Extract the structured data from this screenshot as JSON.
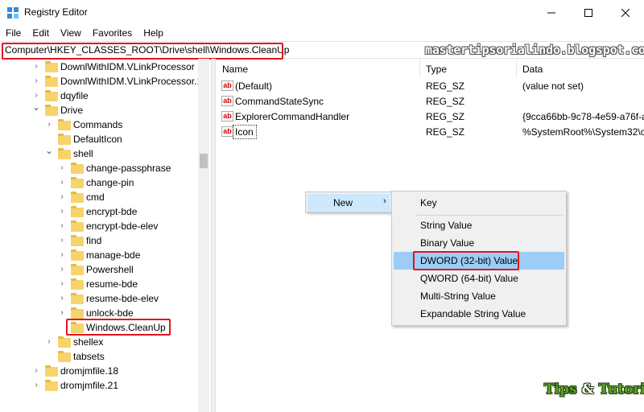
{
  "window": {
    "title": "Registry Editor"
  },
  "menu": [
    "File",
    "Edit",
    "View",
    "Favorites",
    "Help"
  ],
  "address": "Computer\\HKEY_CLASSES_ROOT\\Drive\\shell\\Windows.CleanUp",
  "watermark_url": "mastertipsorialindo.blogspot.com",
  "tree": [
    {
      "label": "DownlWithIDM.VLinkProcessor",
      "expander": "chevron-right"
    },
    {
      "label": "DownlWithIDM.VLinkProcessor.1",
      "expander": "chevron-right"
    },
    {
      "label": "dqyfile",
      "expander": "chevron-right"
    },
    {
      "label": "Drive",
      "expander": "chevron-down"
    },
    {
      "label": "Commands",
      "expander": "chevron-right"
    },
    {
      "label": "DefaultIcon",
      "expander": "none"
    },
    {
      "label": "shell",
      "expander": "chevron-down"
    },
    {
      "label": "change-passphrase",
      "expander": "chevron-right"
    },
    {
      "label": "change-pin",
      "expander": "chevron-right"
    },
    {
      "label": "cmd",
      "expander": "chevron-right"
    },
    {
      "label": "encrypt-bde",
      "expander": "chevron-right"
    },
    {
      "label": "encrypt-bde-elev",
      "expander": "chevron-right"
    },
    {
      "label": "find",
      "expander": "chevron-right"
    },
    {
      "label": "manage-bde",
      "expander": "chevron-right"
    },
    {
      "label": "Powershell",
      "expander": "chevron-right"
    },
    {
      "label": "resume-bde",
      "expander": "chevron-right"
    },
    {
      "label": "resume-bde-elev",
      "expander": "chevron-right"
    },
    {
      "label": "unlock-bde",
      "expander": "chevron-right"
    },
    {
      "label": "Windows.CleanUp",
      "expander": "none"
    },
    {
      "label": "shellex",
      "expander": "chevron-right"
    },
    {
      "label": "tabsets",
      "expander": "none"
    },
    {
      "label": "dromjmfile.18",
      "expander": "chevron-right"
    },
    {
      "label": "dromjmfile.21",
      "expander": "chevron-right"
    }
  ],
  "columns": {
    "name": "Name",
    "type": "Type",
    "data": "Data"
  },
  "values": [
    {
      "name": "(Default)",
      "type": "REG_SZ",
      "data": "(value not set)"
    },
    {
      "name": "CommandStateSync",
      "type": "REG_SZ",
      "data": ""
    },
    {
      "name": "ExplorerCommandHandler",
      "type": "REG_SZ",
      "data": "{9cca66bb-9c78-4e59-a76f-a"
    },
    {
      "name": "Icon",
      "type": "REG_SZ",
      "data": "%SystemRoot%\\System32\\c"
    }
  ],
  "context_menu": {
    "new_label": "New",
    "arrow": "›"
  },
  "submenu": {
    "key": "Key",
    "items": [
      "String Value",
      "Binary Value",
      "DWORD (32-bit) Value",
      "QWORD (64-bit) Value",
      "Multi-String Value",
      "Expandable String Value"
    ],
    "highlighted": "DWORD (32-bit) Value"
  },
  "logo": {
    "part1": "Tips ",
    "amp": "&",
    "part2": " Tutorial"
  },
  "colors": {
    "highlight_border": "#e0141e",
    "menu_hover": "#9bcdf6",
    "folder": "#f7d36b"
  }
}
